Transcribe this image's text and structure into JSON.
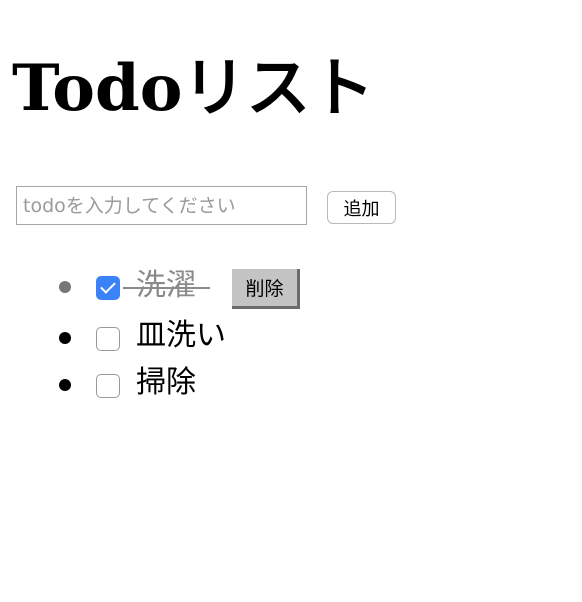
{
  "page": {
    "title": "Todoリスト"
  },
  "form": {
    "input_placeholder": "todoを入力してください",
    "input_value": "",
    "add_label": "追加"
  },
  "todos": [
    {
      "text": "洗濯",
      "completed": true,
      "delete_label": "削除"
    },
    {
      "text": "皿洗い",
      "completed": false
    },
    {
      "text": "掃除",
      "completed": false
    }
  ],
  "colors": {
    "checked_checkbox": "#3b82f6",
    "completed_text": "#8a8a8a",
    "delete_button_bg": "#c4c4c4"
  }
}
